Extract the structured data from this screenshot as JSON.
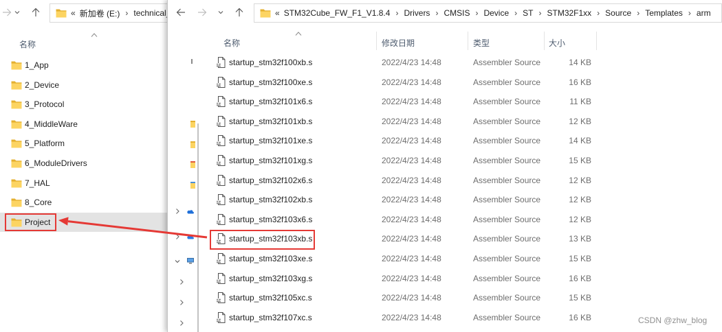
{
  "left_window": {
    "nav": {
      "forward_icon": "arrow-right-icon",
      "recent_icon": "chevron-down-icon",
      "up_icon": "arrow-up-icon"
    },
    "address": {
      "folder_icon": "folder-icon",
      "overflow": "«",
      "drive": "新加卷 (E:)",
      "separator": "›",
      "partial_segment": "technical_"
    },
    "column_header": {
      "name": "名称",
      "sort_icon": "sort-ascending-icon"
    },
    "folders": [
      {
        "name": "1_App"
      },
      {
        "name": "2_Device"
      },
      {
        "name": "3_Protocol"
      },
      {
        "name": "4_MiddleWare"
      },
      {
        "name": "5_Platform"
      },
      {
        "name": "6_ModuleDrivers"
      },
      {
        "name": "7_HAL"
      },
      {
        "name": "8_Core"
      },
      {
        "name": "Project",
        "selected": true,
        "highlighted": true
      }
    ]
  },
  "right_window": {
    "nav": {
      "back_icon": "arrow-left-icon",
      "forward_icon": "arrow-right-icon",
      "recent_icon": "chevron-down-icon",
      "up_icon": "arrow-up-icon"
    },
    "address": {
      "folder_icon": "folder-icon",
      "overflow": "«",
      "separator": "›",
      "breadcrumb": [
        "STM32Cube_FW_F1_V1.8.4",
        "Drivers",
        "CMSIS",
        "Device",
        "ST",
        "STM32F1xx",
        "Source",
        "Templates",
        "arm"
      ]
    },
    "nav_pane": {
      "expand_icon": "chevron-right-icon",
      "collapse_icon": "chevron-down-icon",
      "item_icons": [
        "folder-icon",
        "onedrive-icon",
        "computer-icon"
      ]
    },
    "columns": {
      "name": "名称",
      "date": "修改日期",
      "type": "类型",
      "size": "大小",
      "sort_icon": "sort-ascending-icon"
    },
    "files": [
      {
        "name": "startup_stm32f100xb.s",
        "date": "2022/4/23 14:48",
        "type": "Assembler Source",
        "size": "14 KB"
      },
      {
        "name": "startup_stm32f100xe.s",
        "date": "2022/4/23 14:48",
        "type": "Assembler Source",
        "size": "16 KB"
      },
      {
        "name": "startup_stm32f101x6.s",
        "date": "2022/4/23 14:48",
        "type": "Assembler Source",
        "size": "11 KB"
      },
      {
        "name": "startup_stm32f101xb.s",
        "date": "2022/4/23 14:48",
        "type": "Assembler Source",
        "size": "12 KB"
      },
      {
        "name": "startup_stm32f101xe.s",
        "date": "2022/4/23 14:48",
        "type": "Assembler Source",
        "size": "14 KB"
      },
      {
        "name": "startup_stm32f101xg.s",
        "date": "2022/4/23 14:48",
        "type": "Assembler Source",
        "size": "15 KB"
      },
      {
        "name": "startup_stm32f102x6.s",
        "date": "2022/4/23 14:48",
        "type": "Assembler Source",
        "size": "12 KB"
      },
      {
        "name": "startup_stm32f102xb.s",
        "date": "2022/4/23 14:48",
        "type": "Assembler Source",
        "size": "12 KB"
      },
      {
        "name": "startup_stm32f103x6.s",
        "date": "2022/4/23 14:48",
        "type": "Assembler Source",
        "size": "12 KB"
      },
      {
        "name": "startup_stm32f103xb.s",
        "date": "2022/4/23 14:48",
        "type": "Assembler Source",
        "size": "13 KB",
        "highlighted": true
      },
      {
        "name": "startup_stm32f103xe.s",
        "date": "2022/4/23 14:48",
        "type": "Assembler Source",
        "size": "15 KB"
      },
      {
        "name": "startup_stm32f103xg.s",
        "date": "2022/4/23 14:48",
        "type": "Assembler Source",
        "size": "16 KB"
      },
      {
        "name": "startup_stm32f105xc.s",
        "date": "2022/4/23 14:48",
        "type": "Assembler Source",
        "size": "15 KB"
      },
      {
        "name": "startup_stm32f107xc.s",
        "date": "2022/4/23 14:48",
        "type": "Assembler Source",
        "size": "16 KB"
      }
    ]
  },
  "annotation": {
    "arrow_icon": "red-arrow-icon"
  },
  "watermark": "CSDN @zhw_blog",
  "colors": {
    "highlight_red": "#e53935",
    "selected_row": "#e3e3e3",
    "secondary_text": "#6d6d6d",
    "folder_yellow": "#fcd462"
  }
}
